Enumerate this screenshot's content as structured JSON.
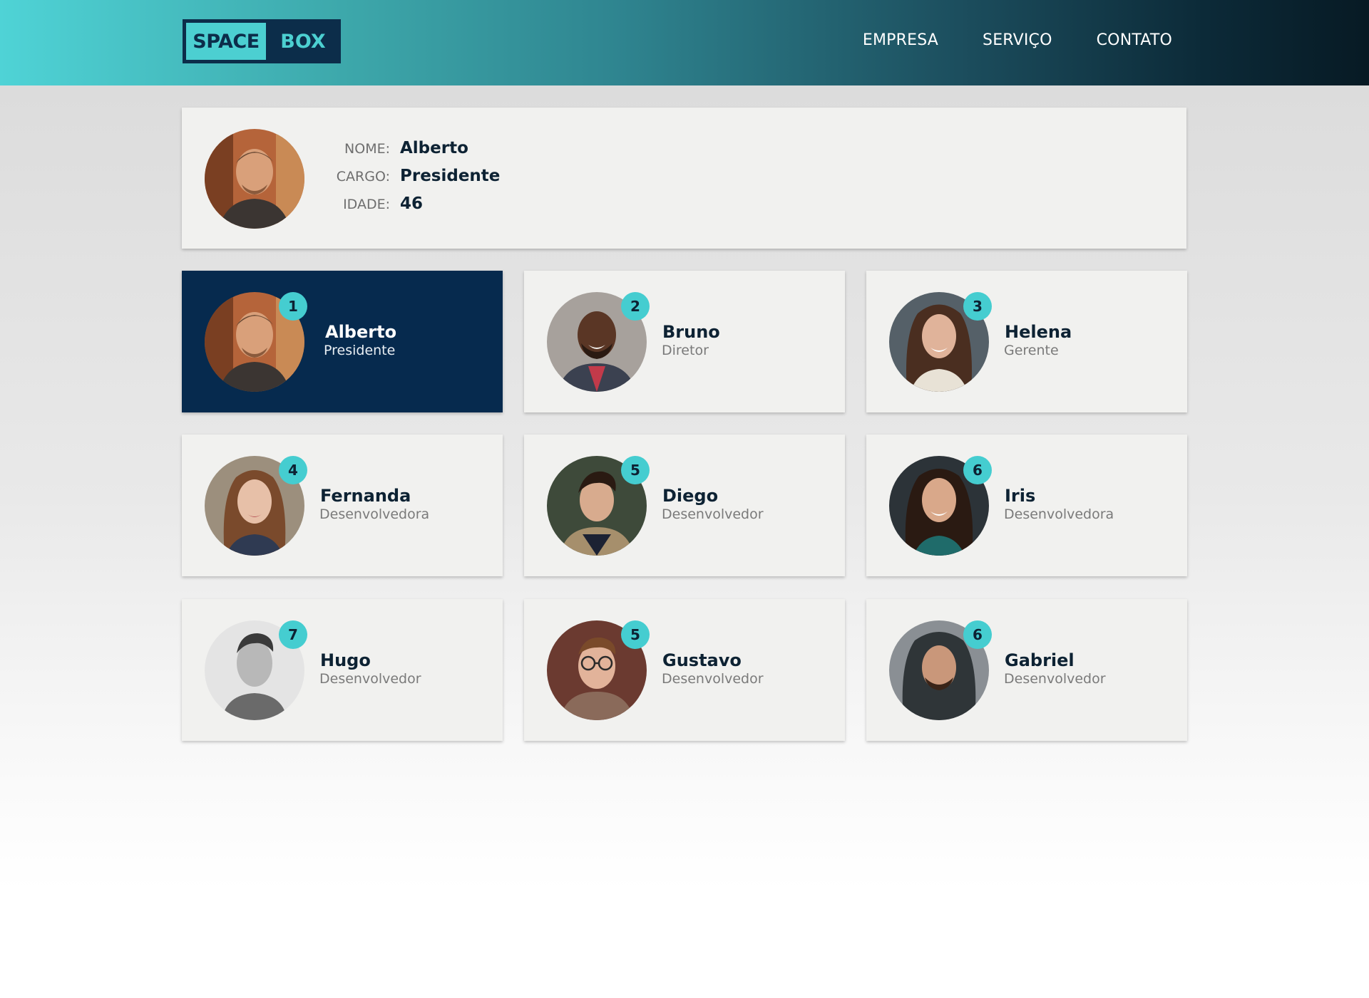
{
  "header": {
    "logo_left": "SPACE",
    "logo_right": "BOX",
    "nav": [
      "EMPRESA",
      "SERVIÇO",
      "CONTATO"
    ]
  },
  "detail": {
    "labels": {
      "name": "NOME:",
      "role": "CARGO:",
      "age": "IDADE:"
    },
    "name": "Alberto",
    "role": "Presidente",
    "age": "46"
  },
  "people": [
    {
      "badge": "1",
      "name": "Alberto",
      "role": "Presidente"
    },
    {
      "badge": "2",
      "name": "Bruno",
      "role": "Diretor"
    },
    {
      "badge": "3",
      "name": "Helena",
      "role": "Gerente"
    },
    {
      "badge": "4",
      "name": "Fernanda",
      "role": "Desenvolvedora"
    },
    {
      "badge": "5",
      "name": "Diego",
      "role": "Desenvolvedor"
    },
    {
      "badge": "6",
      "name": "Iris",
      "role": "Desenvolvedora"
    },
    {
      "badge": "7",
      "name": "Hugo",
      "role": "Desenvolvedor"
    },
    {
      "badge": "5",
      "name": "Gustavo",
      "role": "Desenvolvedor"
    },
    {
      "badge": "6",
      "name": "Gabriel",
      "role": "Desenvolvedor"
    }
  ],
  "colors": {
    "accent": "#45cdd0",
    "active_card": "#062a4e",
    "card": "#f1f1ef",
    "text_dark": "#0d2233"
  }
}
